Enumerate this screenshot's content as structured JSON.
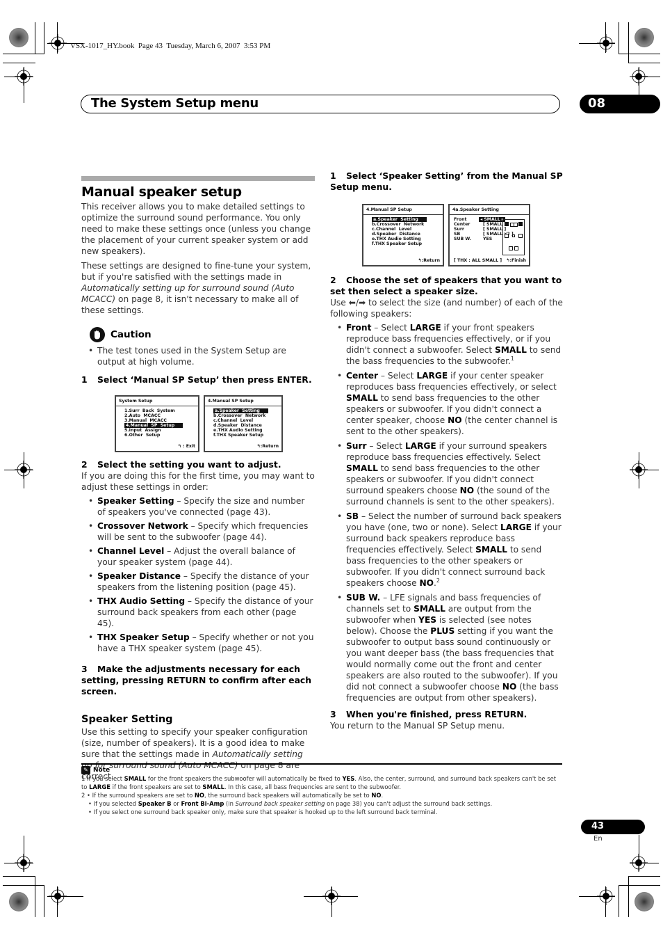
{
  "book_info": "VSX-1017_HY.book  Page 43  Tuesday, March 6, 2007  3:53 PM",
  "header": {
    "title": "The System Setup menu",
    "chapter": "08"
  },
  "left": {
    "heading": "Manual speaker setup",
    "intro_p1": "This receiver allows you to make detailed settings to optimize the surround sound performance. You only need to make these settings once (unless you change the placement of your current speaker system or add new speakers).",
    "intro_p2_a": "These settings are designed to fine-tune your system, but if you're satisfied with the settings made in ",
    "intro_p2_i": "Automatically setting up for surround sound (Auto MCACC)",
    "intro_p2_b": " on page 8, it isn't necessary to make all of these settings.",
    "caution_label": "Caution",
    "caution_text": "The test tones used in the System Setup are output at high volume.",
    "step1_num": "1",
    "step1": "Select ‘Manual SP Setup’ then press ENTER.",
    "screen1": {
      "title": "System  Setup",
      "items": [
        "1.Surr  Back  System",
        "2.Auto  MCACC",
        "3.Manual  MCACC",
        "4.Manual  SP  Setup",
        "5.Input  Assign",
        "6.Other  Setup"
      ],
      "selected": "4.Manual  SP  Setup",
      "footer": "↰ : Exit"
    },
    "screen2": {
      "title": "4.Manual  SP  Setup",
      "items": [
        "a.Speaker  Setting",
        "b.Crossover  Network",
        "c.Channel  Level",
        "d.Speaker  Distance",
        "e.THX Audio Setting",
        "f.THX Speaker Setup"
      ],
      "selected": "a.Speaker  Setting",
      "footer": "↰:Return"
    },
    "step2_num": "2",
    "step2": "Select the setting you want to adjust.",
    "step2_text": "If you are doing this for the first time, you may want to adjust these settings in order:",
    "settings": [
      {
        "term": "Speaker Setting",
        "desc": " – Specify the size and number of speakers you've connected (page 43)."
      },
      {
        "term": "Crossover Network",
        "desc": " – Specify which frequencies will be sent to the subwoofer (page 44)."
      },
      {
        "term": "Channel Level",
        "desc": " – Adjust the overall balance of your speaker system (page 44)."
      },
      {
        "term": "Speaker Distance",
        "desc": " – Specify the distance of your speakers from the listening position (page 45)."
      },
      {
        "term": "THX Audio Setting",
        "desc": " – Specify the distance of your surround back speakers from each other (page 45)."
      },
      {
        "term": "THX Speaker Setup",
        "desc": " – Specify whether or not you have a THX speaker system (page 45)."
      }
    ],
    "step3_num": "3",
    "step3": "Make the adjustments necessary for each setting, pressing RETURN to confirm after each screen.",
    "sub_heading": "Speaker Setting",
    "sub_p_a": "Use this setting to specify your speaker configuration (size, number of speakers). It is a good idea to make sure that the settings made in ",
    "sub_p_i": "Automatically setting up for surround sound (Auto MCACC)",
    "sub_p_b": " on page 8 are correct."
  },
  "right": {
    "step1_num": "1",
    "step1": "Select ‘Speaker Setting’ from the Manual SP Setup menu.",
    "screen3": {
      "title": "4.Manual  SP  Setup",
      "items": [
        "a.Speaker  Setting",
        "b.Crossover  Network",
        "c.Channel  Level",
        "d.Speaker  Distance",
        "e.THX Audio Setting",
        "f.THX Speaker Setup"
      ],
      "selected": "a.Speaker  Setting",
      "footer": "↰:Return"
    },
    "screen4": {
      "title": "4a.Speaker  Setting",
      "rows": [
        {
          "label": "Front",
          "value": "◂ SMALL ▸"
        },
        {
          "label": "Center",
          "value": "[ SMALL ]"
        },
        {
          "label": "Surr",
          "value": "[ SMALL ]"
        },
        {
          "label": "SB",
          "value": "[ SMALL x2 ]"
        },
        {
          "label": "SUB W.",
          "value": "YES"
        }
      ],
      "footer_left": "[ THX : ALL SMALL ]",
      "footer": "↰:Finish"
    },
    "step2_num": "2",
    "step2": "Choose the set of speakers that you want to set then select a speaker size.",
    "step2_text": "Use ⬅/➡ to select the size (and number) of each of the following speakers:",
    "speakers": [
      {
        "term": "Front",
        "html": " – Select <b>LARGE</b> if your front speakers reproduce bass frequencies effectively, or if you didn't connect a subwoofer. Select <b>SMALL</b> to send the bass frequencies to the subwoofer.<sup>1</sup>"
      },
      {
        "term": "Center",
        "html": " – Select <b>LARGE</b> if your center speaker reproduces bass frequencies effectively, or select <b>SMALL</b> to send bass frequencies to the other speakers or subwoofer. If you didn't connect a center speaker, choose <b>NO</b> (the center channel is sent to the other speakers)."
      },
      {
        "term": "Surr",
        "html": " – Select <b>LARGE</b> if your surround speakers reproduce bass frequencies effectively. Select <b>SMALL</b> to send bass frequencies to the other speakers or subwoofer. If you didn't connect surround speakers choose <b>NO</b> (the sound of the surround channels is sent to the other speakers)."
      },
      {
        "term": "SB",
        "html": " – Select the number of surround back speakers you have (one, two or none). Select <b>LARGE</b> if your surround back speakers reproduce bass frequencies effectively. Select <b>SMALL</b> to send bass frequencies to the other speakers or subwoofer. If you didn't connect surround back speakers choose <b>NO</b>.<sup>2</sup>"
      },
      {
        "term": "SUB W.",
        "html": " – LFE signals and bass frequencies of channels set to <b>SMALL</b> are output from the subwoofer when <b>YES</b> is selected (see notes below). Choose the <b>PLUS</b> setting if you want the subwoofer to output bass sound continuously or you want deeper bass (the bass frequencies that would normally come out the front and center speakers are also routed to the subwoofer). If you did not connect a subwoofer choose <b>NO</b> (the bass frequencies are output from other speakers)."
      }
    ],
    "step3_num": "3",
    "step3": "When you're finished, press RETURN.",
    "step3_text": "You return to the Manual SP Setup menu."
  },
  "note": {
    "label": "Note",
    "lines": [
      "1  If you select <b>SMALL</b> for the front speakers the subwoofer will automatically be fixed to <b>YES</b>. Also, the center, surround, and surround back speakers can't be set to <b>LARGE</b> if the front speakers are set to <b>SMALL</b>. In this case, all bass frequencies are sent to the subwoofer.",
      "2  • If the surround speakers are set to <b>NO</b>, the surround back speakers will automatically be set to <b>NO</b>.",
      "• If you selected <b>Speaker B</b> or <b>Front Bi-Amp</b> (in <i>Surround back speaker setting</i> on page 38) you can't adjust the surround back settings.",
      "• If you select one surround back speaker only, make sure that speaker is hooked up to the left surround back terminal."
    ]
  },
  "page": {
    "number": "43",
    "lang": "En"
  }
}
